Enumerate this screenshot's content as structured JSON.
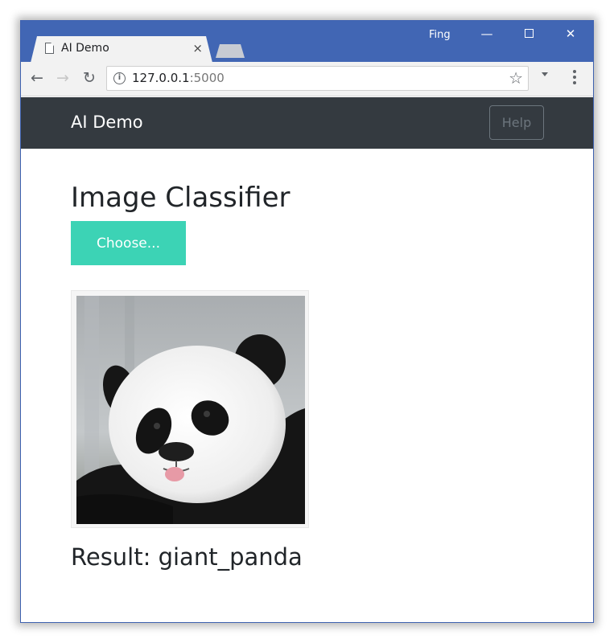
{
  "browser": {
    "tab_title": "AI Demo",
    "tab_close": "×",
    "profile_name": "Fing",
    "url_host": "127.0.0.1",
    "url_port": ":5000"
  },
  "icons": {
    "back": "arrow-left-icon",
    "forward": "arrow-right-icon",
    "reload": "reload-icon",
    "info": "info-icon",
    "bookmark": "star-icon",
    "menu": "vertical-dots-icon"
  },
  "navbar": {
    "brand": "AI Demo",
    "help_label": "Help"
  },
  "main": {
    "title": "Image Classifier",
    "choose_label": "Choose...",
    "result_text": "Result: giant_panda"
  },
  "colors": {
    "chrome_blue": "#4166b4",
    "navbar_bg": "#343a40",
    "choose_button": "#3cd3b5"
  }
}
